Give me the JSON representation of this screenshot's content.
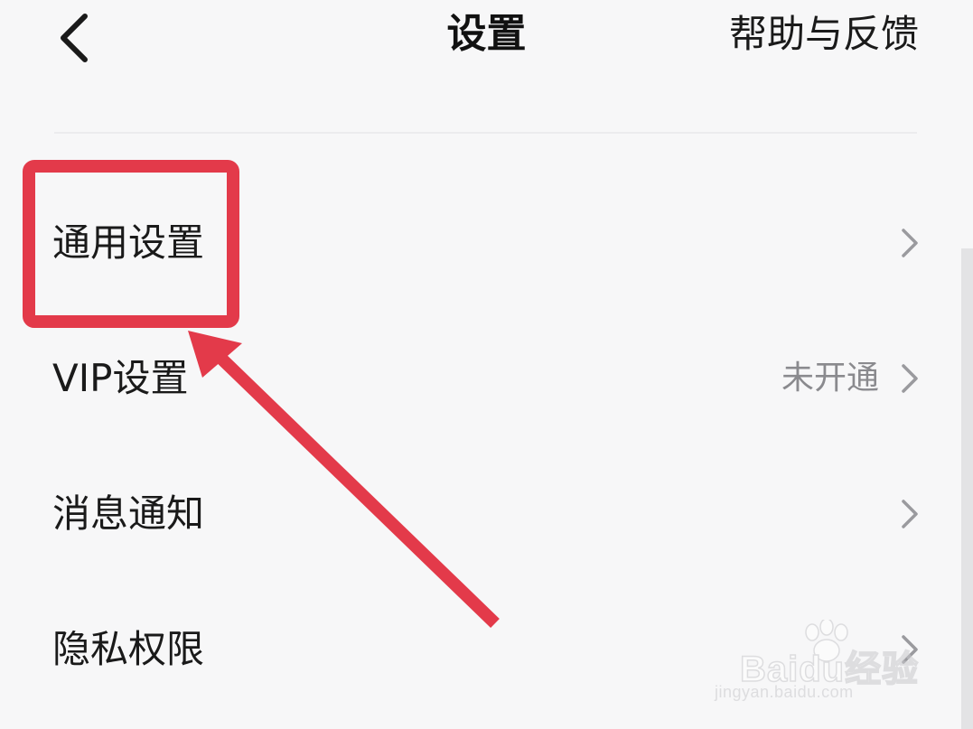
{
  "header": {
    "title": "设置",
    "help_label": "帮助与反馈"
  },
  "settings": [
    {
      "label": "通用设置",
      "value": ""
    },
    {
      "label": "VIP设置",
      "value": "未开通"
    },
    {
      "label": "消息通知",
      "value": ""
    },
    {
      "label": "隐私权限",
      "value": ""
    }
  ],
  "annotation": {
    "color": "#e33a4a"
  },
  "watermark": {
    "brand": "Baidu经验",
    "url": "jingyan.baidu.com"
  },
  "colors": {
    "background": "#f7f7f8",
    "text_primary": "#1a1a1a",
    "text_secondary": "#8a8a8e",
    "chevron": "#9a9a9e"
  }
}
